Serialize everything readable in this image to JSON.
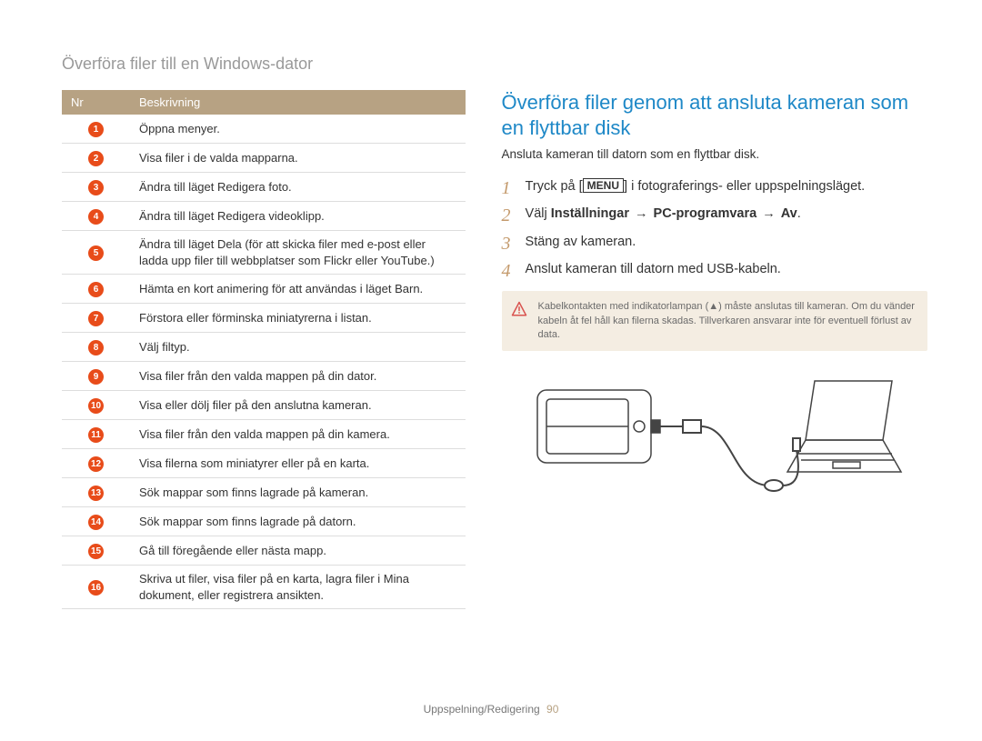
{
  "breadcrumb": "Överföra filer till en Windows-dator",
  "table": {
    "headers": {
      "nr": "Nr",
      "desc": "Beskrivning"
    },
    "rows": [
      {
        "n": "1",
        "d": "Öppna menyer."
      },
      {
        "n": "2",
        "d": "Visa filer i de valda mapparna."
      },
      {
        "n": "3",
        "d": "Ändra till läget Redigera foto."
      },
      {
        "n": "4",
        "d": "Ändra till läget Redigera videoklipp."
      },
      {
        "n": "5",
        "d": "Ändra till läget Dela (för att skicka filer med e-post eller ladda upp filer till webbplatser som Flickr eller YouTube.)"
      },
      {
        "n": "6",
        "d": "Hämta en kort animering för att användas i läget Barn."
      },
      {
        "n": "7",
        "d": "Förstora eller förminska miniatyrerna i listan."
      },
      {
        "n": "8",
        "d": "Välj filtyp."
      },
      {
        "n": "9",
        "d": "Visa filer från den valda mappen på din dator."
      },
      {
        "n": "10",
        "d": "Visa eller dölj filer på den anslutna kameran."
      },
      {
        "n": "11",
        "d": "Visa filer från den valda mappen på din kamera."
      },
      {
        "n": "12",
        "d": "Visa filerna som miniatyrer eller på en karta."
      },
      {
        "n": "13",
        "d": "Sök mappar som finns lagrade på kameran."
      },
      {
        "n": "14",
        "d": "Sök mappar som finns lagrade på datorn."
      },
      {
        "n": "15",
        "d": "Gå till föregående eller nästa mapp."
      },
      {
        "n": "16",
        "d": "Skriva ut filer, visa filer på en karta, lagra filer i Mina dokument, eller registrera ansikten."
      }
    ]
  },
  "right": {
    "title": "Överföra filer genom att ansluta kameran som en flyttbar disk",
    "subtitle": "Ansluta kameran till datorn som en flyttbar disk.",
    "menu_label": "MENU",
    "steps": {
      "s1_a": "Tryck på [",
      "s1_b": "] i fotograferings- eller uppspelningsläget.",
      "s2_a": "Välj ",
      "s2_b": "Inställningar",
      "s2_c": "PC-programvara",
      "s2_d": "Av",
      "s2_arrow": "→",
      "s2_dot": ".",
      "s3": "Stäng av kameran.",
      "s4": "Anslut kameran till datorn med USB-kabeln."
    },
    "warning": "Kabelkontakten med indikatorlampan (▲) måste anslutas till kameran. Om du vänder kabeln åt fel håll kan filerna skadas. Tillverkaren ansvarar inte för eventuell förlust av data."
  },
  "footer": {
    "section": "Uppspelning/Redigering",
    "page": "90"
  }
}
